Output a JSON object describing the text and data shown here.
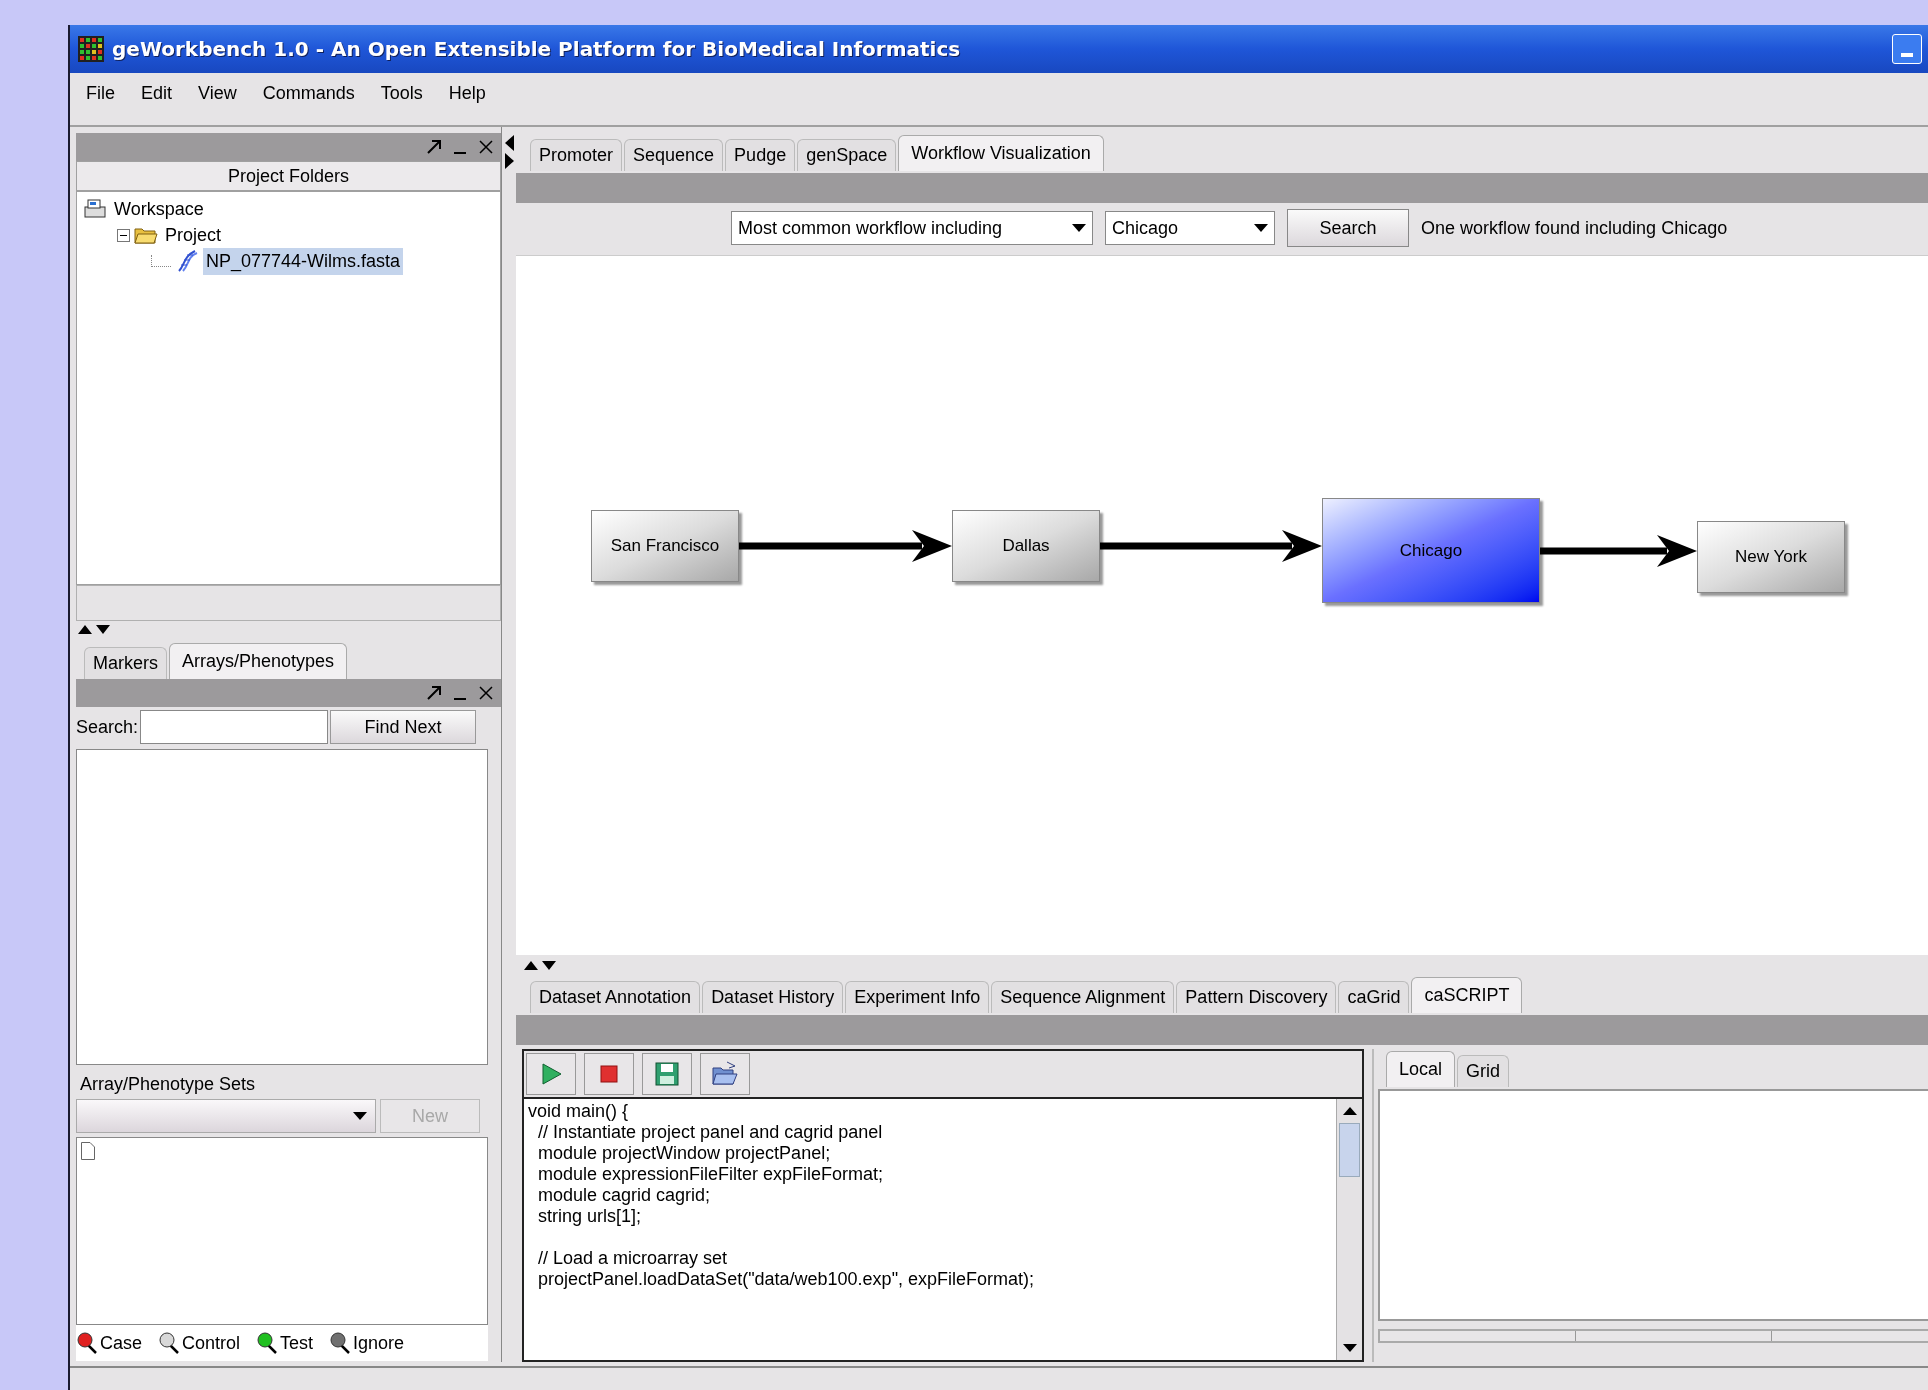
{
  "window": {
    "title": "geWorkbench 1.0 - An Open Extensible Platform for BioMedical Informatics"
  },
  "menu": [
    "File",
    "Edit",
    "View",
    "Commands",
    "Tools",
    "Help"
  ],
  "project_panel": {
    "header": "Project Folders",
    "tree": [
      {
        "label": "Workspace",
        "kind": "workspace",
        "selected": false,
        "children": [
          {
            "label": "Project",
            "kind": "folder",
            "selected": false,
            "expanded": true,
            "children": [
              {
                "label": "NP_077744-Wilms.fasta",
                "kind": "sequence",
                "selected": true
              }
            ]
          }
        ]
      }
    ]
  },
  "left_tabs": [
    {
      "label": "Markers",
      "selected": false
    },
    {
      "label": "Arrays/Phenotypes",
      "selected": true
    }
  ],
  "arrays_panel": {
    "search_label": "Search:",
    "find_button": "Find Next",
    "sets_label": "Array/Phenotype Sets",
    "new_button": {
      "label": "New",
      "disabled": true
    },
    "legend": [
      {
        "label": "Case",
        "color": "#e02020"
      },
      {
        "label": "Control",
        "color": "#d8d8d8"
      },
      {
        "label": "Test",
        "color": "#20c020"
      },
      {
        "label": "Ignore",
        "color": "#707070"
      }
    ]
  },
  "main_tabs": [
    {
      "label": "Promoter",
      "selected": false
    },
    {
      "label": "Sequence",
      "selected": false
    },
    {
      "label": "Pudge",
      "selected": false
    },
    {
      "label": "genSpace",
      "selected": false
    },
    {
      "label": "Workflow Visualization",
      "selected": true
    }
  ],
  "workflow": {
    "mode": "Most common workflow including",
    "city": "Chicago",
    "search_button": "Search",
    "result": "One workflow found including Chicago",
    "nodes": [
      {
        "label": "San Francisco",
        "selected": false
      },
      {
        "label": "Dallas",
        "selected": false
      },
      {
        "label": "Chicago",
        "selected": true
      },
      {
        "label": "New York",
        "selected": false
      }
    ]
  },
  "bottom_tabs": [
    {
      "label": "Dataset Annotation",
      "selected": false
    },
    {
      "label": "Dataset History",
      "selected": false
    },
    {
      "label": "Experiment Info",
      "selected": false
    },
    {
      "label": "Sequence Alignment",
      "selected": false
    },
    {
      "label": "Pattern Discovery",
      "selected": false
    },
    {
      "label": "caGrid",
      "selected": false
    },
    {
      "label": "caSCRIPT",
      "selected": true
    }
  ],
  "script": {
    "blocks": [
      [
        "void main() {",
        "  // Instantiate project panel and cagrid panel",
        "  module projectWindow projectPanel;",
        "  module expressionFileFilter expFileFormat;",
        "  module cagrid cagrid;",
        "  string urls[1];"
      ],
      [
        "  // Load a microarray set",
        "  projectPanel.loadDataSet(\"data/web100.exp\", expFileFormat);"
      ]
    ]
  },
  "result_tabs": [
    {
      "label": "Local",
      "selected": true
    },
    {
      "label": "Grid",
      "selected": false
    }
  ]
}
